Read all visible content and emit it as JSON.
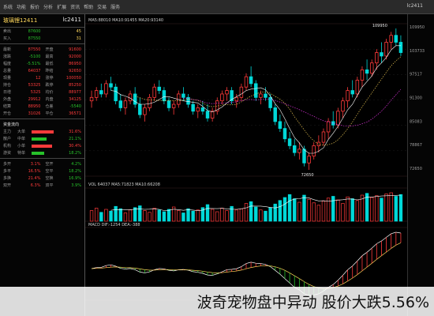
{
  "topbar": {
    "menu": [
      "系统",
      "功能",
      "报价",
      "分析",
      "扩展",
      "资讯",
      "帮助",
      "交易",
      "服务"
    ],
    "code": "lc2411",
    "controls": [
      "—",
      "□",
      "×"
    ]
  },
  "quote": {
    "name": "玻璃锂12411",
    "code": "lc2411",
    "sell_label": "卖出",
    "sell_price": "87600",
    "sell_qty": "45",
    "buy_label": "买入",
    "buy_price": "87550",
    "buy_qty": "31",
    "rows": [
      {
        "l": "最新",
        "v": "87550",
        "l2": "开盘",
        "v2": "91600"
      },
      {
        "l": "涨跌",
        "v": "-5100",
        "l2": "最高",
        "v2": "92000"
      },
      {
        "l": "幅度",
        "v": "-5.51%",
        "l2": "最低",
        "v2": "86950"
      },
      {
        "l": "总量",
        "v": "64037",
        "l2": "昨结",
        "v2": "92650"
      },
      {
        "l": "现量",
        "v": "12",
        "l2": "涨停",
        "v2": "100050"
      },
      {
        "l": "持仓",
        "v": "53325",
        "l2": "跌停",
        "v2": "85250"
      },
      {
        "l": "日增",
        "v": "5325",
        "l2": "均价",
        "v2": "88977"
      },
      {
        "l": "外盘",
        "v": "29912",
        "l2": "内盘",
        "v2": "34125"
      },
      {
        "l": "结算",
        "v": "88950",
        "l2": "仓差",
        "v2": "-5540"
      },
      {
        "l": "开仓",
        "v": "31026",
        "l2": "平仓",
        "v2": "36571"
      }
    ],
    "flow_title": "资金流向",
    "flows": [
      {
        "l": "主力",
        "v": "大单",
        "pct": "31.6%",
        "color": "#ff3b3b",
        "w": 0.46
      },
      {
        "l": "散户",
        "v": "中单",
        "pct": "21.1%",
        "color": "#27c12a",
        "w": 0.31
      },
      {
        "l": "机构",
        "v": "小单",
        "pct": "30.4%",
        "color": "#ff3b3b",
        "w": 0.44
      },
      {
        "l": "游资",
        "v": "特单",
        "pct": "18.2%",
        "color": "#27c12a",
        "w": 0.26
      }
    ],
    "bottom_rows": [
      {
        "l": "多开",
        "v": "3.1%",
        "l2": "空开",
        "v2": "4.2%"
      },
      {
        "l": "多平",
        "v": "16.5%",
        "l2": "空平",
        "v2": "18.2%"
      },
      {
        "l": "多换",
        "v": "21.4%",
        "l2": "空换",
        "v2": "16.9%"
      },
      {
        "l": "双开",
        "v": "6.3%",
        "l2": "双平",
        "v2": "3.9%"
      }
    ]
  },
  "chart_labels": {
    "main_title": "MA5:88010 MA10:91455 MA20:93140",
    "vol_title": "VOL 64037 MA5:71823 MA10:66208",
    "ind_title": "MACD DIF:-1254 DEA:-388",
    "high_label": "109950",
    "low_label": "72650"
  },
  "chart_data": {
    "type": "bar",
    "title": "",
    "candles": [
      [
        100,
        103,
        98,
        101
      ],
      [
        101,
        104,
        100,
        103
      ],
      [
        103,
        105,
        101,
        102
      ],
      [
        102,
        106,
        101,
        105
      ],
      [
        105,
        107,
        103,
        104
      ],
      [
        104,
        105,
        99,
        100
      ],
      [
        100,
        102,
        97,
        98
      ],
      [
        98,
        101,
        96,
        100
      ],
      [
        100,
        103,
        99,
        102
      ],
      [
        102,
        104,
        98,
        99
      ],
      [
        99,
        101,
        95,
        96
      ],
      [
        96,
        99,
        94,
        98
      ],
      [
        98,
        102,
        97,
        101
      ],
      [
        101,
        105,
        100,
        104
      ],
      [
        104,
        106,
        102,
        103
      ],
      [
        103,
        104,
        99,
        100
      ],
      [
        100,
        101,
        97,
        98
      ],
      [
        98,
        100,
        96,
        99
      ],
      [
        99,
        103,
        98,
        102
      ],
      [
        102,
        104,
        100,
        101
      ],
      [
        101,
        102,
        98,
        99
      ],
      [
        99,
        100,
        96,
        97
      ],
      [
        97,
        99,
        95,
        98
      ],
      [
        98,
        100,
        96,
        97
      ],
      [
        97,
        99,
        94,
        95
      ],
      [
        95,
        98,
        94,
        97
      ],
      [
        97,
        101,
        96,
        100
      ],
      [
        100,
        103,
        99,
        102
      ],
      [
        102,
        104,
        100,
        103
      ],
      [
        103,
        104,
        99,
        100
      ],
      [
        100,
        102,
        98,
        101
      ],
      [
        101,
        105,
        100,
        104
      ],
      [
        104,
        108,
        103,
        107
      ],
      [
        107,
        110,
        104,
        105
      ],
      [
        105,
        106,
        100,
        101
      ],
      [
        101,
        103,
        99,
        102
      ],
      [
        102,
        104,
        100,
        101
      ],
      [
        101,
        102,
        97,
        98
      ],
      [
        98,
        99,
        93,
        94
      ],
      [
        94,
        96,
        91,
        92
      ],
      [
        92,
        94,
        88,
        89
      ],
      [
        89,
        91,
        86,
        87
      ],
      [
        87,
        89,
        84,
        85
      ],
      [
        85,
        88,
        83,
        86
      ],
      [
        86,
        87,
        81,
        82
      ],
      [
        82,
        85,
        80,
        84
      ],
      [
        84,
        88,
        83,
        87
      ],
      [
        87,
        90,
        85,
        88
      ],
      [
        88,
        92,
        87,
        91
      ],
      [
        91,
        95,
        89,
        94
      ],
      [
        94,
        97,
        92,
        93
      ],
      [
        93,
        98,
        92,
        97
      ],
      [
        97,
        101,
        95,
        100
      ],
      [
        100,
        104,
        98,
        103
      ],
      [
        103,
        106,
        101,
        102
      ],
      [
        102,
        107,
        101,
        106
      ],
      [
        106,
        110,
        104,
        109
      ],
      [
        109,
        112,
        106,
        108
      ],
      [
        108,
        112,
        107,
        111
      ],
      [
        111,
        115,
        109,
        114
      ],
      [
        114,
        117,
        111,
        113
      ],
      [
        113,
        118,
        112,
        117
      ],
      [
        117,
        120,
        115,
        119
      ],
      [
        119,
        121,
        116,
        117
      ],
      [
        117,
        119,
        113,
        114
      ]
    ],
    "volumes": [
      18,
      22,
      15,
      20,
      17,
      25,
      21,
      14,
      19,
      23,
      26,
      18,
      15,
      22,
      19,
      16,
      20,
      24,
      18,
      14,
      21,
      17,
      19,
      23,
      28,
      20,
      16,
      22,
      18,
      25,
      19,
      21,
      30,
      33,
      24,
      19,
      17,
      23,
      29,
      35,
      40,
      45,
      38,
      32,
      44,
      37,
      31,
      27,
      34,
      39,
      42,
      36,
      30,
      41,
      38,
      35,
      44,
      47,
      40,
      43,
      39,
      46,
      48,
      42,
      45
    ],
    "volume_colors_up": true,
    "y_range": [
      72650,
      109950
    ]
  }
}
